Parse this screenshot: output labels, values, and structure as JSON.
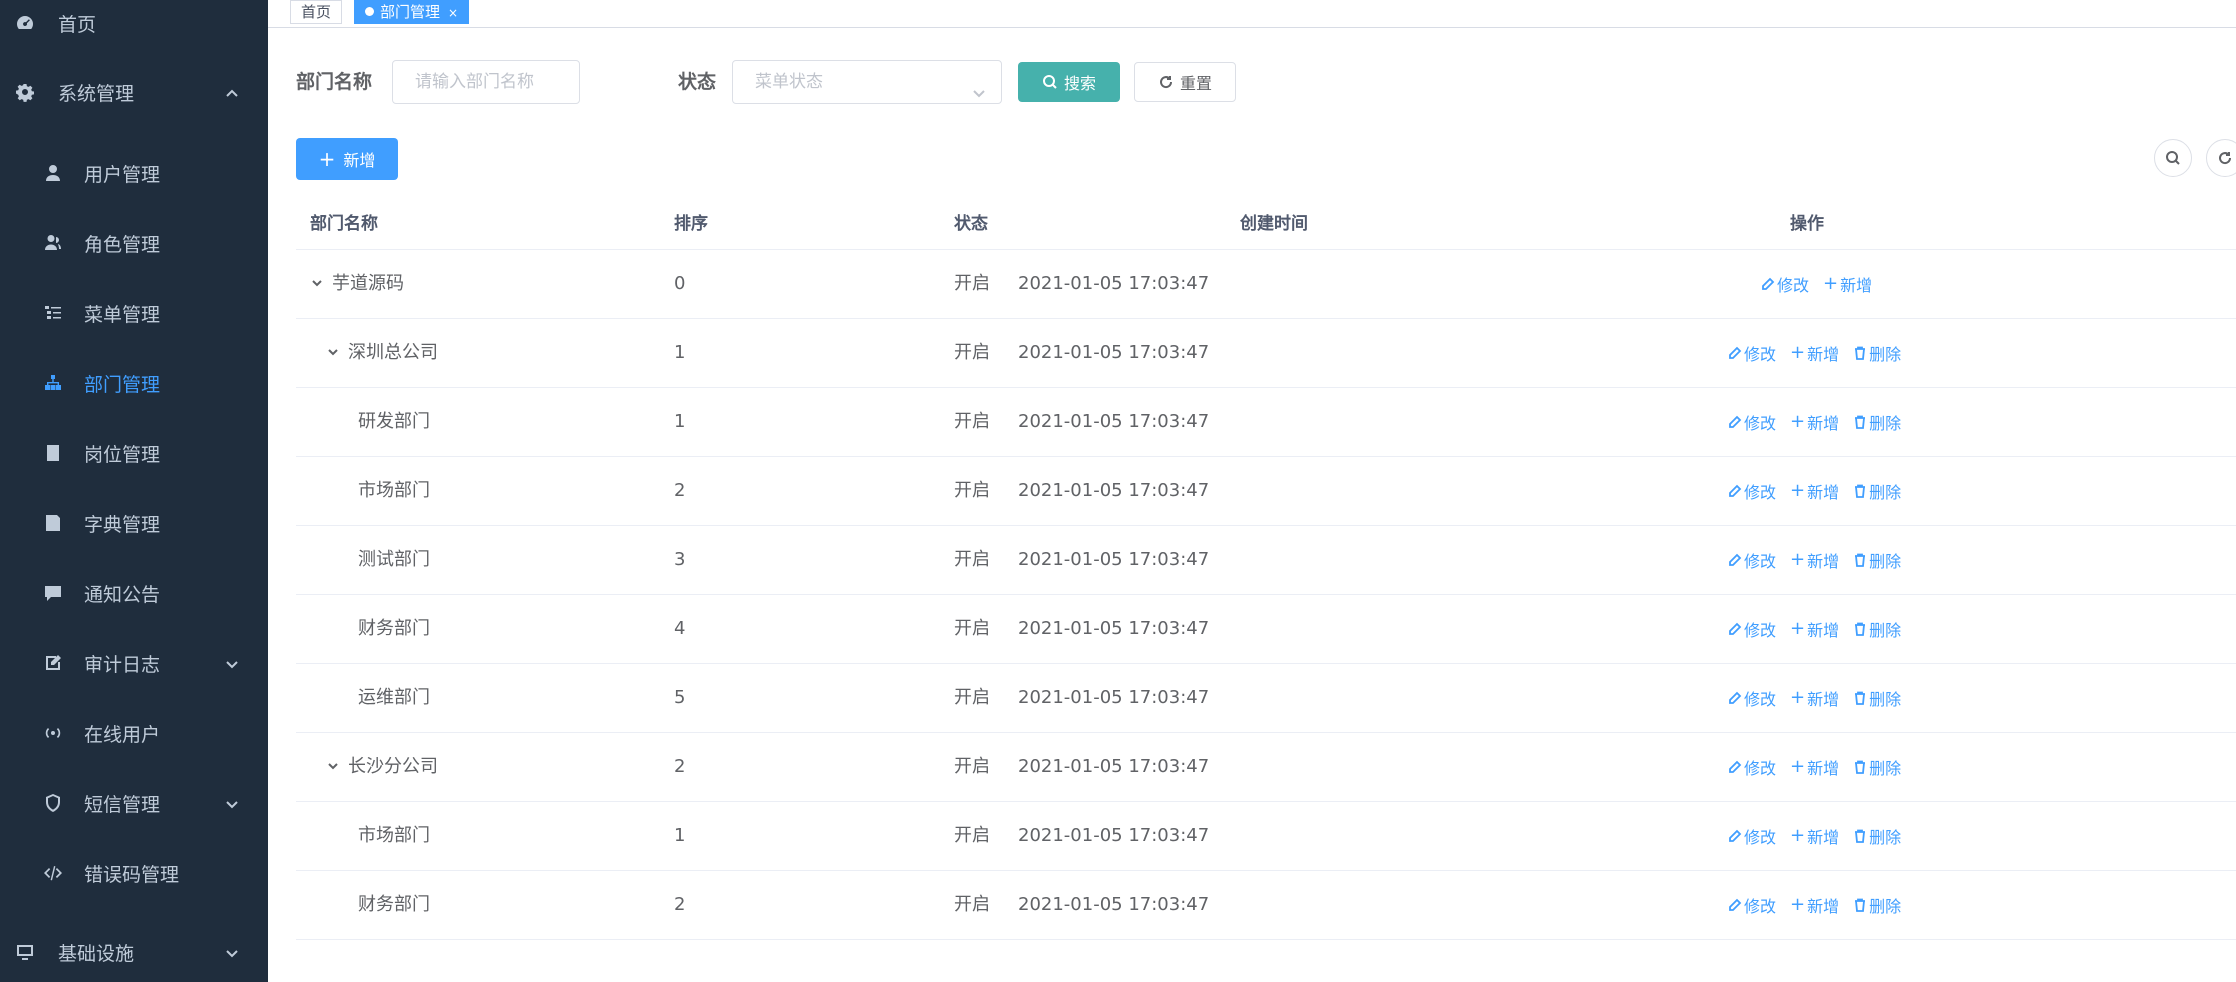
{
  "colors": {
    "sidebar_bg": "#1f2d3d",
    "primary": "#409eff",
    "search_btn": "#46b1ac"
  },
  "sidebar": {
    "home": {
      "label": "首页",
      "icon": "dashboard-icon"
    },
    "system": {
      "label": "系统管理",
      "icon": "gear-icon",
      "expanded": true,
      "items": [
        {
          "label": "用户管理",
          "icon": "user-icon"
        },
        {
          "label": "角色管理",
          "icon": "peoples-icon"
        },
        {
          "label": "菜单管理",
          "icon": "tree-table-icon"
        },
        {
          "label": "部门管理",
          "icon": "tree-icon",
          "active": true
        },
        {
          "label": "岗位管理",
          "icon": "post-icon"
        },
        {
          "label": "字典管理",
          "icon": "dict-icon"
        },
        {
          "label": "通知公告",
          "icon": "message-icon"
        },
        {
          "label": "审计日志",
          "icon": "log-icon",
          "has_children": true
        },
        {
          "label": "在线用户",
          "icon": "online-icon"
        },
        {
          "label": "短信管理",
          "icon": "shield-icon",
          "has_children": true
        },
        {
          "label": "错误码管理",
          "icon": "code-icon"
        }
      ]
    },
    "infra": {
      "label": "基础设施",
      "icon": "monitor-icon"
    }
  },
  "tags": [
    {
      "label": "首页",
      "active": false
    },
    {
      "label": "部门管理",
      "active": true,
      "close": "×"
    }
  ],
  "search": {
    "name_label": "部门名称",
    "name_placeholder": "请输入部门名称",
    "status_label": "状态",
    "status_placeholder": "菜单状态",
    "search_btn": "搜索",
    "reset_btn": "重置"
  },
  "toolbar": {
    "add_btn": "新增"
  },
  "table": {
    "columns": [
      "部门名称",
      "排序",
      "状态",
      "创建时间",
      "操作"
    ],
    "actions": {
      "edit": "修改",
      "add": "新增",
      "delete": "删除"
    },
    "rows": [
      {
        "name": "芋道源码",
        "level": 0,
        "expanded": true,
        "sort": "0",
        "status": "开启",
        "created": "2021-01-05 17:03:47",
        "can_delete": false
      },
      {
        "name": "深圳总公司",
        "level": 1,
        "expanded": true,
        "sort": "1",
        "status": "开启",
        "created": "2021-01-05 17:03:47",
        "can_delete": true
      },
      {
        "name": "研发部门",
        "level": 2,
        "sort": "1",
        "status": "开启",
        "created": "2021-01-05 17:03:47",
        "can_delete": true
      },
      {
        "name": "市场部门",
        "level": 2,
        "sort": "2",
        "status": "开启",
        "created": "2021-01-05 17:03:47",
        "can_delete": true
      },
      {
        "name": "测试部门",
        "level": 2,
        "sort": "3",
        "status": "开启",
        "created": "2021-01-05 17:03:47",
        "can_delete": true
      },
      {
        "name": "财务部门",
        "level": 2,
        "sort": "4",
        "status": "开启",
        "created": "2021-01-05 17:03:47",
        "can_delete": true
      },
      {
        "name": "运维部门",
        "level": 2,
        "sort": "5",
        "status": "开启",
        "created": "2021-01-05 17:03:47",
        "can_delete": true
      },
      {
        "name": "长沙分公司",
        "level": 1,
        "expanded": true,
        "sort": "2",
        "status": "开启",
        "created": "2021-01-05 17:03:47",
        "can_delete": true
      },
      {
        "name": "市场部门",
        "level": 2,
        "sort": "1",
        "status": "开启",
        "created": "2021-01-05 17:03:47",
        "can_delete": true
      },
      {
        "name": "财务部门",
        "level": 2,
        "sort": "2",
        "status": "开启",
        "created": "2021-01-05 17:03:47",
        "can_delete": true
      }
    ]
  }
}
